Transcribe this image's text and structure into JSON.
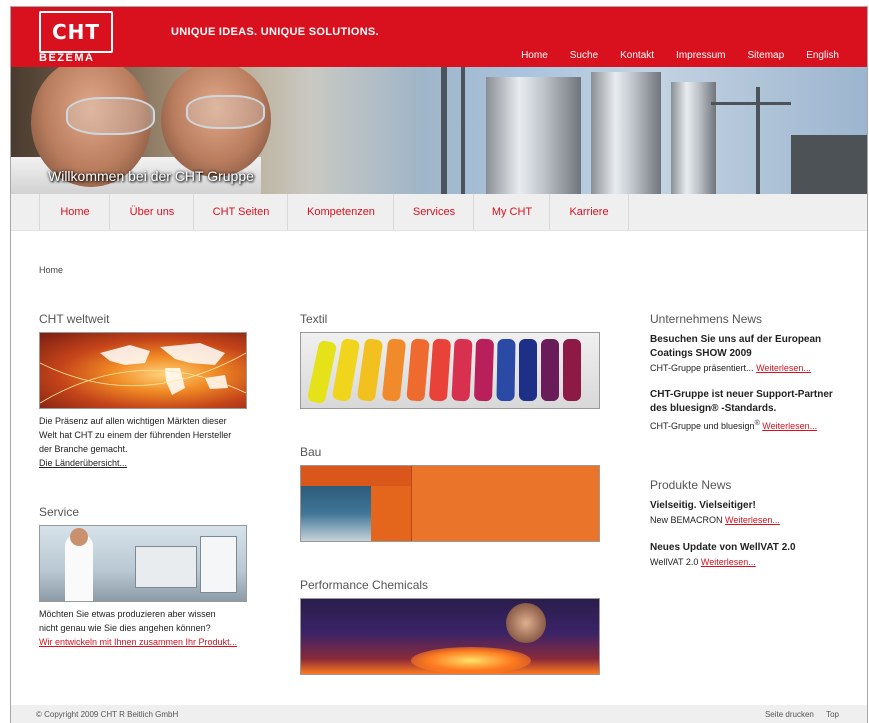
{
  "header": {
    "logo": "CHT",
    "logo_sub": "BEZEMA",
    "tagline": "UNIQUE IDEAS. UNIQUE SOLUTIONS.",
    "top_nav": [
      "Home",
      "Suche",
      "Kontakt",
      "Impressum",
      "Sitemap",
      "English"
    ]
  },
  "hero": {
    "title": "Willkommen bei der CHT Gruppe"
  },
  "main_nav": [
    "Home",
    "Über uns",
    "CHT Seiten",
    "Kompetenzen",
    "Services",
    "My CHT",
    "Karriere"
  ],
  "breadcrumb": "Home",
  "col1": {
    "weltweit": {
      "title": "CHT weltweit",
      "line1": "Die Präsenz auf allen wichtigen Märkten dieser",
      "line2": "Welt hat CHT zu einem der führenden Hersteller",
      "line3": "der Branche gemacht.",
      "link": "Die Länderübersicht..."
    },
    "service": {
      "title": "Service",
      "line1": "Möchten Sie etwas produzieren aber wissen",
      "line2": "nicht genau wie Sie dies angehen können?",
      "link": "Wir entwickeln mit Ihnen zusammen Ihr Produkt..."
    }
  },
  "col2": {
    "textil": "Textil",
    "bau": "Bau",
    "performance": "Performance Chemicals"
  },
  "col3": {
    "unternehmens_news": {
      "title": "Unternehmens News",
      "items": [
        {
          "title1": "Besuchen Sie uns auf der European",
          "title2": "Coatings SHOW 2009",
          "text": "CHT-Gruppe präsentiert...",
          "link": "Weiterlesen..."
        },
        {
          "title1": "CHT-Gruppe ist neuer Support-Partner",
          "title2": "des bluesign® -Standards.",
          "text": "CHT-Gruppe und bluesign",
          "sup": "®",
          "link": "Weiterlesen..."
        }
      ]
    },
    "produkte_news": {
      "title": "Produkte News",
      "items": [
        {
          "title1": "Vielseitig. Vielseitiger!",
          "text": "New BEMACRON",
          "link": "Weiterlesen..."
        },
        {
          "title1": "Neues Update von WellVAT 2.0",
          "text": "WellVAT 2.0",
          "link": "Weiterlesen..."
        }
      ]
    }
  },
  "footer": {
    "copyright": "© Copyright 2009 CHT R Beitlich GmbH",
    "links": [
      "Seite drucken",
      "Top"
    ]
  },
  "colors": {
    "brand_red": "#d9111f",
    "nav_bg": "#efefef"
  }
}
